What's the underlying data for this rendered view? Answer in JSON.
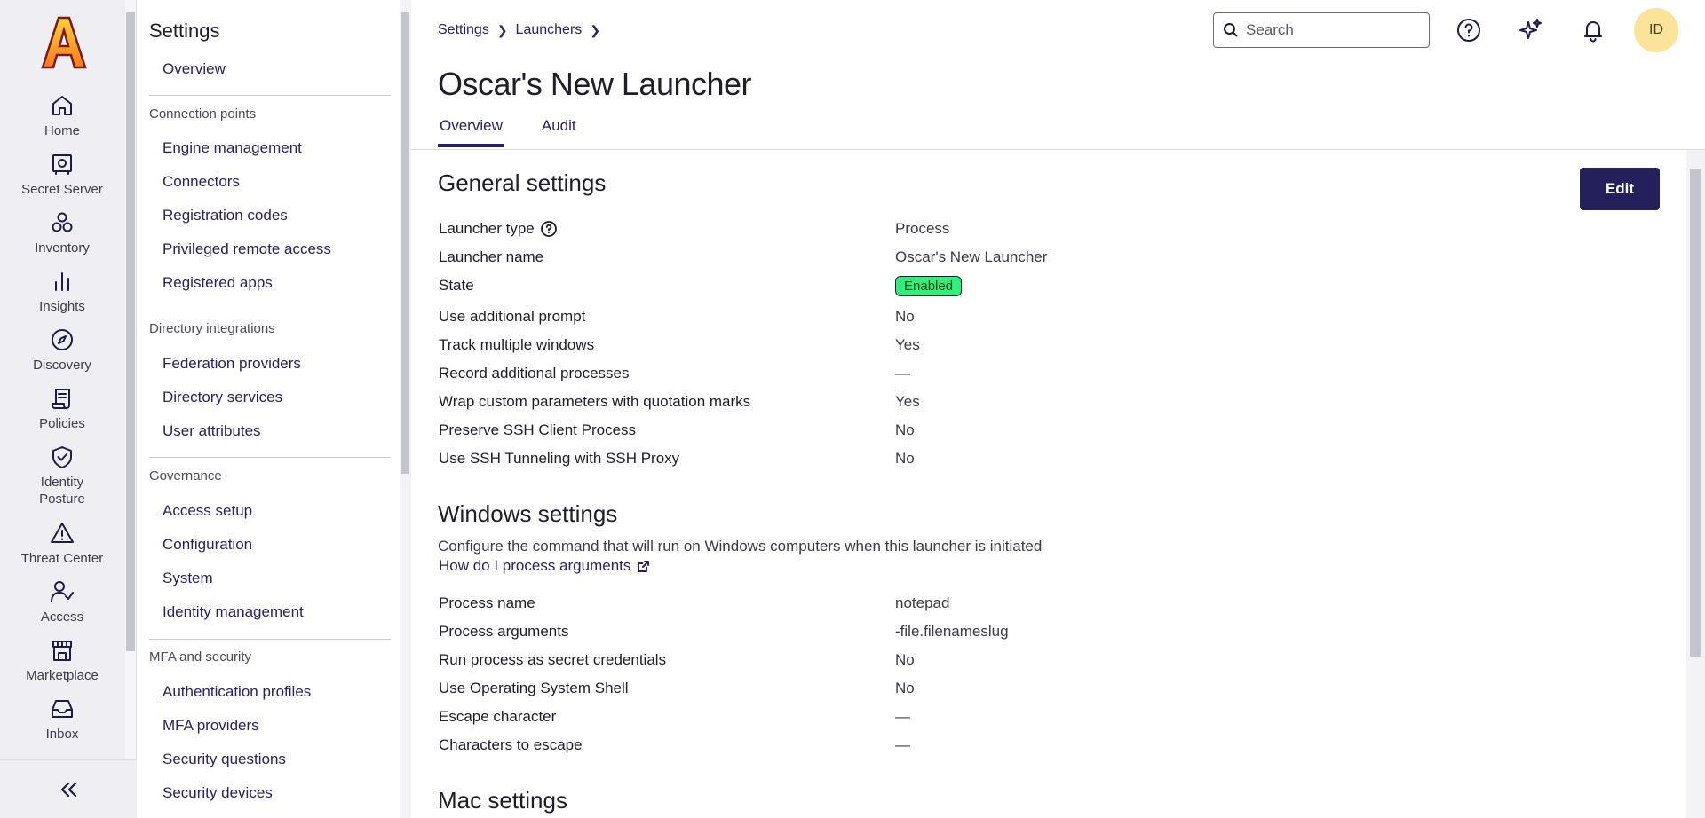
{
  "rail": {
    "items": [
      {
        "label": "Home",
        "icon": "home-icon"
      },
      {
        "label": "Secret Server",
        "icon": "safe-icon"
      },
      {
        "label": "Inventory",
        "icon": "inventory-icon"
      },
      {
        "label": "Insights",
        "icon": "bar-chart-icon"
      },
      {
        "label": "Discovery",
        "icon": "compass-icon"
      },
      {
        "label": "Policies",
        "icon": "scroll-icon"
      },
      {
        "label": "Identity\nPosture",
        "icon": "shield-check-icon"
      },
      {
        "label": "Threat Center",
        "icon": "warning-icon"
      },
      {
        "label": "Access",
        "icon": "user-check-icon"
      },
      {
        "label": "Marketplace",
        "icon": "store-icon"
      },
      {
        "label": "Inbox",
        "icon": "inbox-icon"
      }
    ],
    "collapse_icon": "double-chevron-left-icon"
  },
  "settings_nav": {
    "title": "Settings",
    "overview": "Overview",
    "sections": [
      {
        "title": "Connection points",
        "items": [
          "Engine management",
          "Connectors",
          "Registration codes",
          "Privileged remote access",
          "Registered apps"
        ]
      },
      {
        "title": "Directory integrations",
        "items": [
          "Federation providers",
          "Directory services",
          "User attributes"
        ]
      },
      {
        "title": "Governance",
        "items": [
          "Access setup",
          "Configuration",
          "System",
          "Identity management"
        ]
      },
      {
        "title": "MFA and security",
        "items": [
          "Authentication profiles",
          "MFA providers",
          "Security questions",
          "Security devices"
        ]
      }
    ]
  },
  "header": {
    "breadcrumb": [
      "Settings",
      "Launchers"
    ],
    "search_placeholder": "Search",
    "avatar_initials": "ID"
  },
  "page": {
    "title": "Oscar's New Launcher",
    "tabs": [
      "Overview",
      "Audit"
    ],
    "active_tab": "Overview",
    "edit_label": "Edit"
  },
  "general": {
    "title": "General settings",
    "rows": [
      {
        "label": "Launcher type",
        "value": "Process"
      },
      {
        "label": "Launcher name",
        "value": "Oscar's New Launcher"
      },
      {
        "label": "State",
        "value": "Enabled"
      },
      {
        "label": "Use additional prompt",
        "value": "No"
      },
      {
        "label": "Track multiple windows",
        "value": "Yes"
      },
      {
        "label": "Record additional processes",
        "value": "—"
      },
      {
        "label": "Wrap custom parameters with quotation marks",
        "value": "Yes"
      },
      {
        "label": "Preserve SSH Client Process",
        "value": "No"
      },
      {
        "label": "Use SSH Tunneling with SSH Proxy",
        "value": "No"
      }
    ]
  },
  "windows": {
    "title": "Windows settings",
    "description": "Configure the command that will run on Windows computers when this launcher is initiated",
    "help_link": "How do I process arguments",
    "rows": [
      {
        "label": "Process name",
        "value": "notepad"
      },
      {
        "label": "Process arguments",
        "value": "-file.filenameslug"
      },
      {
        "label": "Run process as secret credentials",
        "value": "No"
      },
      {
        "label": "Use Operating System Shell",
        "value": "No"
      },
      {
        "label": "Escape character",
        "value": "—"
      },
      {
        "label": "Characters to escape",
        "value": "—"
      }
    ]
  },
  "mac": {
    "title": "Mac settings"
  },
  "colors": {
    "accent": "#24205c",
    "link": "#2a2160",
    "badge_enabled": "#2ef07a",
    "avatar_bg": "#fbe39a",
    "rail_bg": "#efeff3"
  }
}
